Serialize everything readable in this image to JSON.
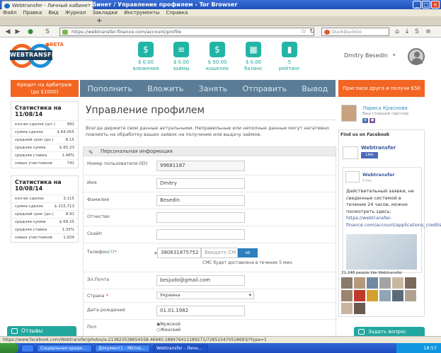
{
  "window": {
    "title": "Webtransfer - Личный кабинет / Управление профилем - Tor Browser"
  },
  "menu": [
    "Файл",
    "Правка",
    "Вид",
    "Журнал",
    "Закладки",
    "Инструменты",
    "Справка"
  ],
  "tab": {
    "label": "Webtransfer - Личный кабинет / Управлен..."
  },
  "url": "https://webtransfer-finance.com/account/profile",
  "search": {
    "placeholder": "DuckDuckGo"
  },
  "brand": {
    "logo": "WEBTRANSFER",
    "beta": "BETA"
  },
  "stats": [
    {
      "value": "$ 0.00",
      "label": "вложения",
      "icon": "piggy-bank-icon"
    },
    {
      "value": "$ 0.00",
      "label": "займы",
      "icon": "coins-icon"
    },
    {
      "value": "$ 50.00",
      "label": "кошелек",
      "icon": "wallet-icon"
    },
    {
      "value": "$ 0.00",
      "label": "баланс",
      "icon": "abacus-icon"
    },
    {
      "value": "5",
      "label": "рейтинг",
      "icon": "rating-chart-icon"
    }
  ],
  "user": {
    "name": "Dmitry Besedin"
  },
  "arbitrage": {
    "line1": "Кредит на Арбитраж",
    "line2": "(до $1000)"
  },
  "nav": [
    "Пополнить",
    "Вложить",
    "Занять",
    "Отправить",
    "Вывод"
  ],
  "invite": "Пригласи друга и получи $50",
  "stats_box1": {
    "title": "Статистика на 11/08/14",
    "rows": [
      [
        "кол-во сделок (шт.)",
        "992"
      ],
      [
        "сумма сделок",
        "$ 64,055"
      ],
      [
        "средний срок (дн.)",
        "8.15"
      ],
      [
        "средняя сумма",
        "$ 65.23"
      ],
      [
        "средняя ставка",
        "1.48%"
      ],
      [
        "новых участников",
        "741"
      ]
    ]
  },
  "stats_box2": {
    "title": "Статистика на 10/08/14",
    "rows": [
      [
        "кол-во сделок",
        "3,115"
      ],
      [
        "сумма сделок",
        "$ 215,713"
      ],
      [
        "средний срок (дн.)",
        "8.91"
      ],
      [
        "средняя сумма",
        "$ 69.25"
      ],
      [
        "средняя ставка",
        "1.33%"
      ],
      [
        "новых участников",
        "1,924"
      ]
    ]
  },
  "page": {
    "title": "Управление профилем",
    "intro": "Всегда держите свои данные актуальными. Неправильные или неполные данные могут негативно повлиять на обработку ваших заявок на получение или выдачу займов."
  },
  "form": {
    "section": "Персональная информация",
    "user_id_label": "Номер пользователя (ID)",
    "user_id": "99681187",
    "first_name_label": "Имя",
    "first_name": "Dmitry",
    "last_name_label": "Фамилия",
    "last_name": "Besedin",
    "patronymic_label": "Отчество",
    "skype_label": "Скайп",
    "phone_label": "Телефон",
    "phone_code": "+",
    "phone": "380631875752",
    "sms_placeholder": "Введите СМ",
    "ok": "ok",
    "sms_note": "СМС будет доставлена в течение 5 мин.",
    "email_label": "Эл.Почта",
    "email": "besjudo@gmail.com",
    "country_label": "Страна",
    "country": "Украина",
    "birth_label": "Дата рождения",
    "birth": "01.01.1982",
    "gender_label": "Пол",
    "gender_options": [
      "Мужской",
      "Женский"
    ]
  },
  "mentor": {
    "name": "Лариса Краснова",
    "role": "Ваш старший партнер"
  },
  "facebook": {
    "title": "Find us on Facebook",
    "page": "Webtransfer",
    "like": "Like",
    "time": "5 hrs",
    "post_text": "Действительный заявки, не сведенные системой в течение 24 часов, можно посмотреть здесь:",
    "post_link": "https://webtransfer-finance.com/account/applications_credits_invest",
    "count": "21,248 people like Webtransfer"
  },
  "reviews_button": "Отзывы участников",
  "ask_button": "Задать вопрос",
  "status": "https://www.facebook.com/Webtransfer/photos/a.213823538654558.46940.188476411189271/728515470518693/?type=1",
  "taskbar": {
    "items": [
      "Социальная креди...",
      "Документ1 - Micros...",
      "Webtransfer - Личн..."
    ],
    "time": "18:57"
  },
  "colors": {
    "orange": "#f26522",
    "teal": "#22b5a6",
    "nav": "#5a7c96",
    "blue": "#1e90d6"
  }
}
